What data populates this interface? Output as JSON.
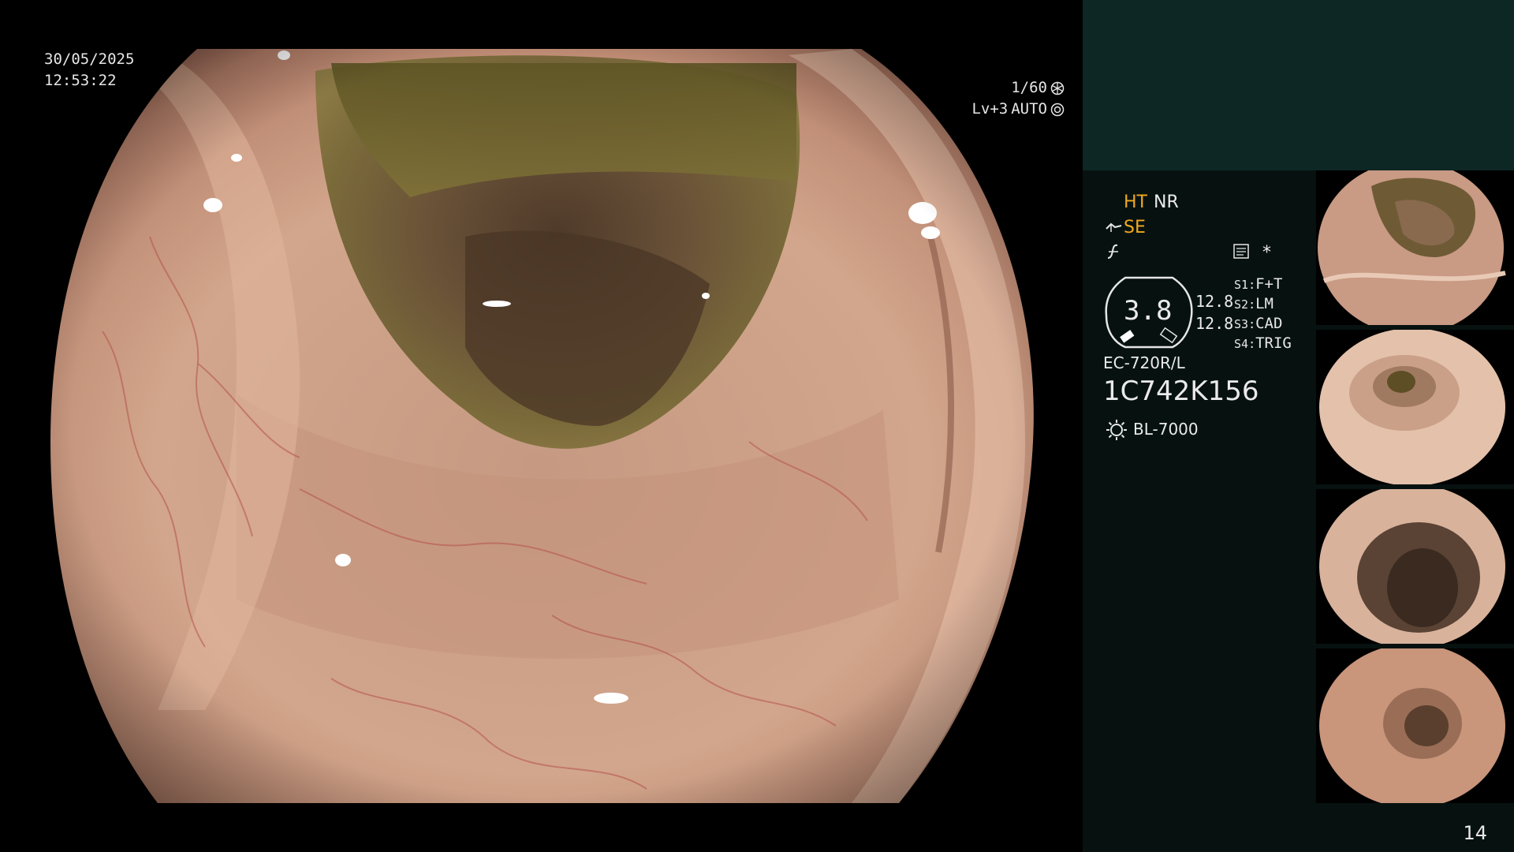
{
  "osd": {
    "date": "30/05/2025",
    "time": "12:53:22",
    "shutter": "1/60",
    "shutter_icon": "aperture-icon",
    "level": "Lv+3",
    "mode": "AUTO",
    "mode_icon": "iris-icon"
  },
  "panel": {
    "ht": "HT",
    "nr": "NR",
    "se": "SE",
    "se_icon": "enhancement-curve-icon",
    "fx_icon": "function-icon",
    "memo_icon": "memo-icon",
    "star": "*",
    "zoom_value": "3.8",
    "zoom_icon": "zoom-gauge-icon",
    "zoom_scale_1": "12.8",
    "zoom_scale_2": "12.8",
    "switches": [
      {
        "key": "S1",
        "value": "F+T"
      },
      {
        "key": "S2",
        "value": "LM"
      },
      {
        "key": "S3",
        "value": "CAD"
      },
      {
        "key": "S4",
        "value": "TRIG"
      }
    ],
    "scope_model": "EC-720R/L",
    "scope_serial": "1C742K156",
    "light_source": "BL-7000",
    "light_icon": "light-source-icon",
    "page_number": "14"
  },
  "colors": {
    "panel_top": "#0d2725",
    "panel_body": "#071210",
    "amber": "#f0a820",
    "osd_text": "#e6e6e6"
  }
}
